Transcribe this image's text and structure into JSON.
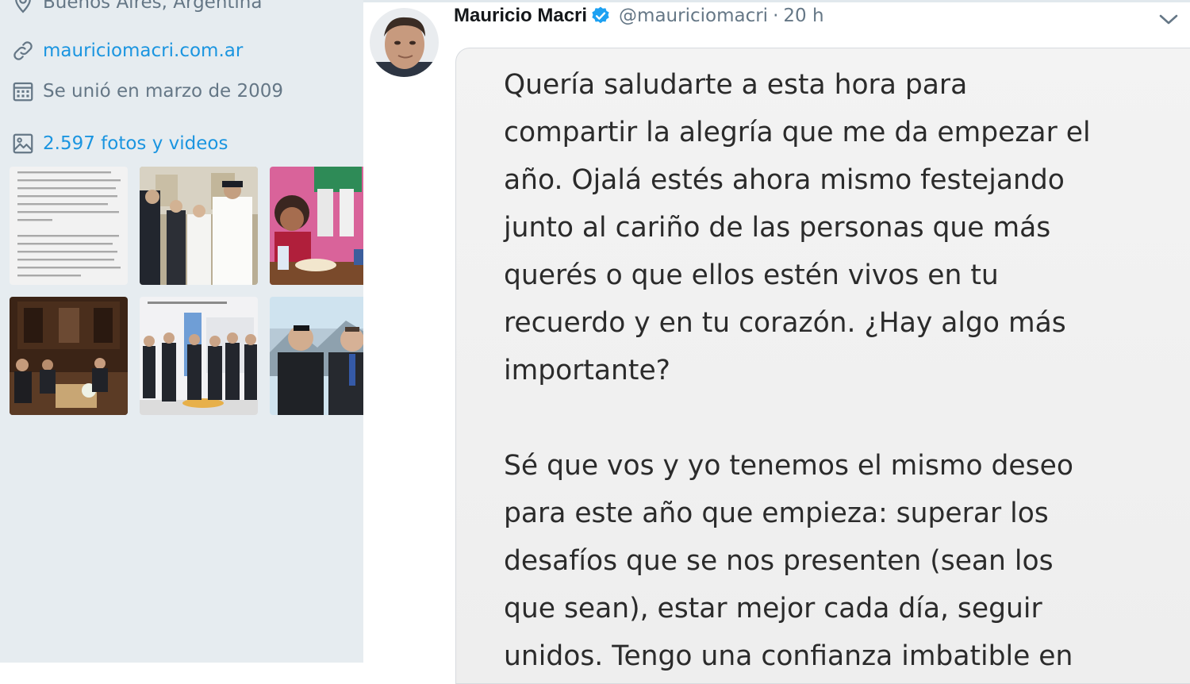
{
  "profile": {
    "location": "Buenos Aires, Argentina",
    "website": "mauriciomacri.com.ar",
    "joined": "Se unió en marzo de 2009",
    "media_count": "2.597 fotos y videos",
    "icons": {
      "location": "location-pin-icon",
      "website": "link-icon",
      "joined": "calendar-icon",
      "media": "image-icon"
    }
  },
  "tweet": {
    "display_name": "Mauricio Macri",
    "verified_icon": "verified-badge-icon",
    "handle": "@mauriciomacri",
    "separator": "·",
    "time": "20 h",
    "menu_icon": "chevron-down-icon",
    "image_paragraph_1": "Quería saludarte a esta hora para\ncompartir la alegría que me da empezar el\naño. Ojalá estés ahora mismo festejando\njunto al cariño de las personas que más\nquerés o que ellos estén vivos en tu\nrecuerdo y en tu corazón. ¿Hay algo más\nimportante?",
    "image_paragraph_2": "Sé que vos y yo tenemos el mismo deseo\npara este año que empieza: superar los\ndesafíos que se nos presenten (sean los\nque sean), estar mejor cada día, seguir\nunidos. Tengo una confianza imbatible en"
  },
  "colors": {
    "sidebar_bg": "#e6ecf0",
    "link": "#1b95e0",
    "muted": "#657786",
    "name": "#14171a",
    "verified": "#1da1f2"
  }
}
